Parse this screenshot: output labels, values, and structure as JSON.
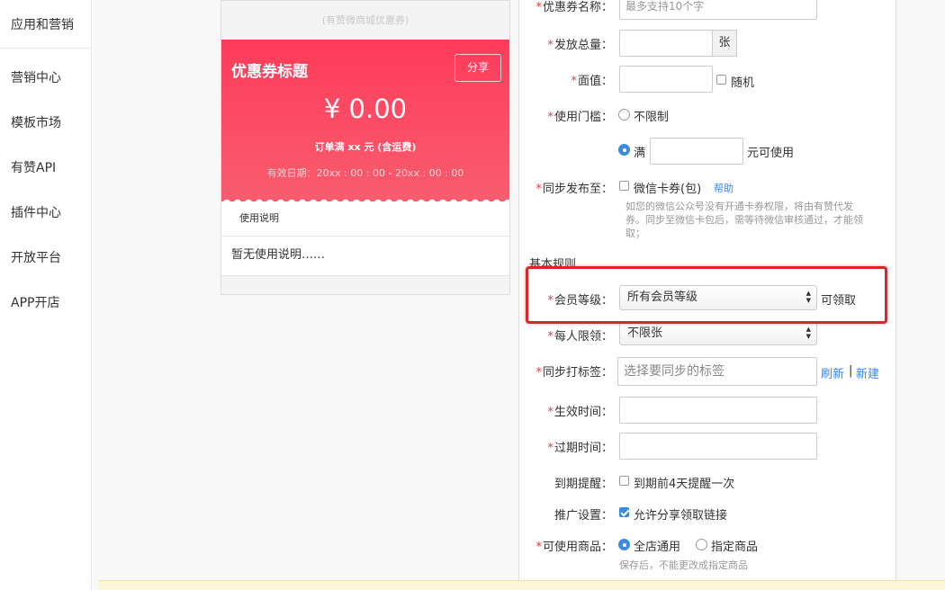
{
  "sidebar": {
    "group_title": "应用和营销",
    "items": [
      {
        "label": "营销中心"
      },
      {
        "label": "模板市场"
      },
      {
        "label": "有赞API"
      },
      {
        "label": "插件中心"
      },
      {
        "label": "开放平台"
      },
      {
        "label": "APP开店"
      }
    ]
  },
  "preview": {
    "subtitle": "(有赞微商城优惠券)",
    "coupon_title": "优惠券标题",
    "share_label": "分享",
    "price": "¥ 0.00",
    "condition": "订单满 xx 元 (含运费)",
    "validity": "有效日期：20xx : 00 : 00 - 20xx : 00 : 00",
    "usage_header": "使用说明",
    "usage_text": "暂无使用说明……"
  },
  "form": {
    "name": {
      "label": "优惠券名称：",
      "placeholder": "最多支持10个字"
    },
    "total": {
      "label": "发放总量：",
      "unit": "张"
    },
    "value": {
      "label": "面值：",
      "random_label": "随机"
    },
    "threshold": {
      "label": "使用门槛：",
      "option_none": "不限制",
      "option_full": "满",
      "suffix": "元可使用"
    },
    "sync": {
      "label": "同步发布至：",
      "wechat_label": "微信卡券(包)",
      "help_link": "帮助",
      "help_text_1": "如您的微信公众号没有开通卡券权限，将由有赞代发",
      "help_text_2": "券。同步至微信卡包后，需等待微信审核通过，才能领",
      "help_text_3": "取；"
    },
    "section_title": "基本规则",
    "member_level": {
      "label": "会员等级：",
      "value": "所有会员等级",
      "suffix": "可领取"
    },
    "per_person": {
      "label": "每人限领：",
      "value": "不限张"
    },
    "tag": {
      "label": "同步打标签：",
      "placeholder": "选择要同步的标签",
      "refresh": "刷新",
      "separator": "|",
      "new": "新建"
    },
    "start_time": {
      "label": "生效时间："
    },
    "end_time": {
      "label": "过期时间："
    },
    "reminder": {
      "label": "到期提醒：",
      "option": "到期前4天提醒一次"
    },
    "promo": {
      "label": "推广设置：",
      "option": "允许分享领取链接"
    },
    "products": {
      "label": "可使用商品：",
      "option_all": "全店通用",
      "option_specific": "指定商品",
      "help": "保存后，不能更改成指定商品"
    }
  }
}
